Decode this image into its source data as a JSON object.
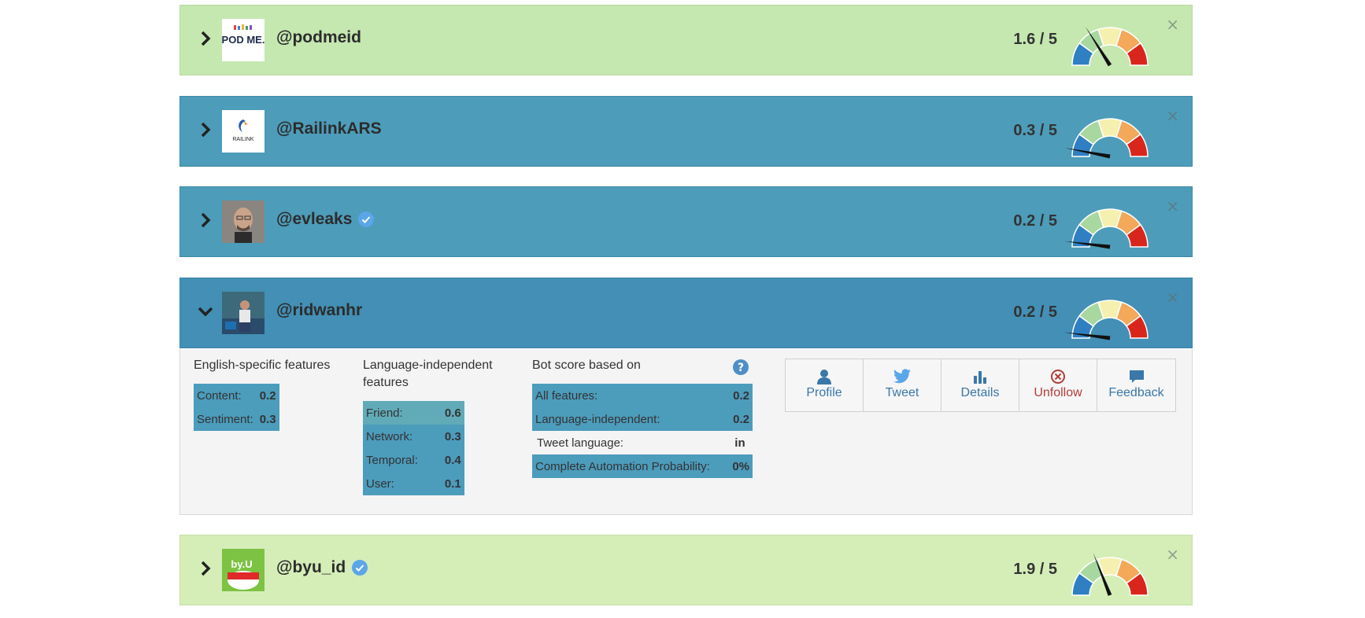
{
  "rows": [
    {
      "handle": "@podmeid",
      "score": "1.6 / 5",
      "verified": false,
      "value": 1.6,
      "avatar_text": "POD ME."
    },
    {
      "handle": "@RailinkARS",
      "score": "0.3 / 5",
      "verified": false,
      "value": 0.3,
      "avatar_text": "RAILINK"
    },
    {
      "handle": "@evleaks",
      "score": "0.2 / 5",
      "verified": true,
      "value": 0.2
    },
    {
      "handle": "@ridwanhr",
      "score": "0.2 / 5",
      "verified": false,
      "value": 0.2,
      "expanded": true
    },
    {
      "handle": "@byu_id",
      "score": "1.9 / 5",
      "verified": true,
      "value": 1.9,
      "avatar_text": "by.U"
    }
  ],
  "close_symbol": "×",
  "details": {
    "english": {
      "title": "English-specific features",
      "rows": [
        {
          "label": "Content:",
          "value": "0.2"
        },
        {
          "label": "Sentiment:",
          "value": "0.3"
        }
      ]
    },
    "language_independent": {
      "title_line1": "Language-independent",
      "title_line2": "features",
      "rows": [
        {
          "label": "Friend:",
          "value": "0.6"
        },
        {
          "label": "Network:",
          "value": "0.3"
        },
        {
          "label": "Temporal:",
          "value": "0.4"
        },
        {
          "label": "User:",
          "value": "0.1"
        }
      ]
    },
    "bot_score": {
      "title": "Bot score based on",
      "rows": [
        {
          "label": "All features:",
          "value": "0.2"
        },
        {
          "label": "Language-independent:",
          "value": "0.2"
        },
        {
          "label": "Tweet language:",
          "value": "in"
        },
        {
          "label": "Complete Automation Probability:",
          "value": "0%"
        }
      ]
    },
    "actions": [
      {
        "label": "Profile",
        "icon": "user-icon"
      },
      {
        "label": "Tweet",
        "icon": "twitter-icon"
      },
      {
        "label": "Details",
        "icon": "bar-chart-icon"
      },
      {
        "label": "Unfollow",
        "icon": "unfollow-icon"
      },
      {
        "label": "Feedback",
        "icon": "comment-icon"
      }
    ]
  },
  "colors": {
    "green_row": "#c5e7b0",
    "blue_row": "#4d9cb9",
    "action_blue": "#3b77a8",
    "action_red": "#b33c3c"
  }
}
